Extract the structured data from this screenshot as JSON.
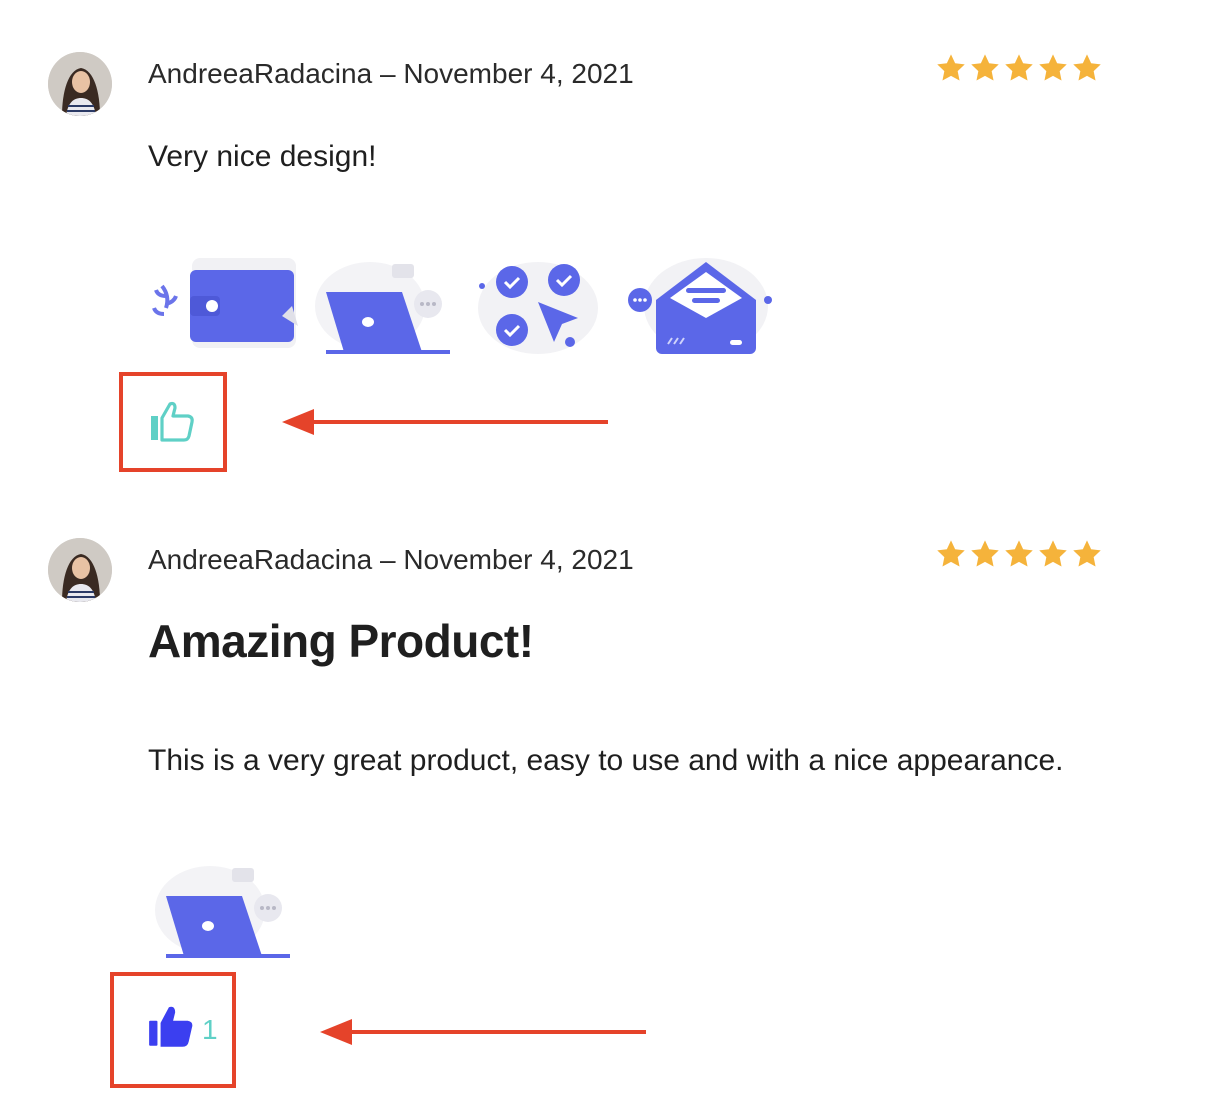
{
  "reviews": [
    {
      "author": "AndreeaRadacina",
      "separator": "–",
      "date": "November 4, 2021",
      "rating": 5,
      "title": "",
      "text": "Very nice design!",
      "attachments": [
        "wallet-illustration",
        "laptop-illustration",
        "checkmarks-illustration",
        "envelope-illustration"
      ],
      "liked": false,
      "like_count": ""
    },
    {
      "author": "AndreeaRadacina",
      "separator": "–",
      "date": "November 4, 2021",
      "rating": 5,
      "title": "Amazing Product!",
      "text": "This is a very great product, easy to use and with a nice appearance.",
      "attachments": [
        "laptop-illustration"
      ],
      "liked": true,
      "like_count": "1"
    }
  ],
  "colors": {
    "star": "#f5b33b",
    "like_outline": "#5fd0c6",
    "like_filled": "#3b3ff0",
    "highlight": "#e5432a",
    "illustration": "#5b67e8"
  },
  "icons": {
    "like_empty": "thumbs-up-outline-icon",
    "like_filled": "thumbs-up-filled-icon",
    "star": "star-icon"
  }
}
